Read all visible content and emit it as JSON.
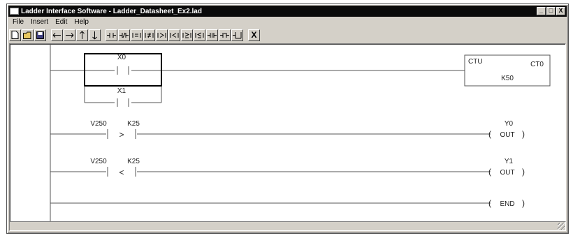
{
  "window": {
    "title": "Ladder Interface Software - Ladder_Datasheet_Ex2.lad",
    "controls": {
      "minimize": "_",
      "maximize": "□",
      "close": "X"
    }
  },
  "menu": [
    "File",
    "Insert",
    "Edit",
    "Help"
  ],
  "toolbar": {
    "buttons": [
      "new-icon",
      "open-icon",
      "save-icon",
      "arrow-left-icon",
      "arrow-right-icon",
      "arrow-up-icon",
      "arrow-down-icon",
      "no-contact-icon",
      "nc-contact-icon",
      "equal-compare-icon",
      "not-equal-compare-icon",
      "greater-compare-icon",
      "less-compare-icon",
      "greater-equal-compare-icon",
      "less-equal-compare-icon",
      "parallel-icon",
      "branch-icon",
      "output-icon",
      "delete-icon"
    ],
    "delete_glyph": "X"
  },
  "ladder": {
    "rung1": {
      "contact1": "X0",
      "contact2": "X1",
      "counter": {
        "type": "CTU",
        "name": "CT0",
        "preset": "K50"
      }
    },
    "rung2": {
      "left": "V250",
      "right": "K25",
      "op": ">",
      "coil_name": "Y0",
      "coil": "OUT"
    },
    "rung3": {
      "left": "V250",
      "right": "K25",
      "op": "<",
      "coil_name": "Y1",
      "coil": "OUT"
    },
    "rung4": {
      "coil": "END"
    }
  }
}
